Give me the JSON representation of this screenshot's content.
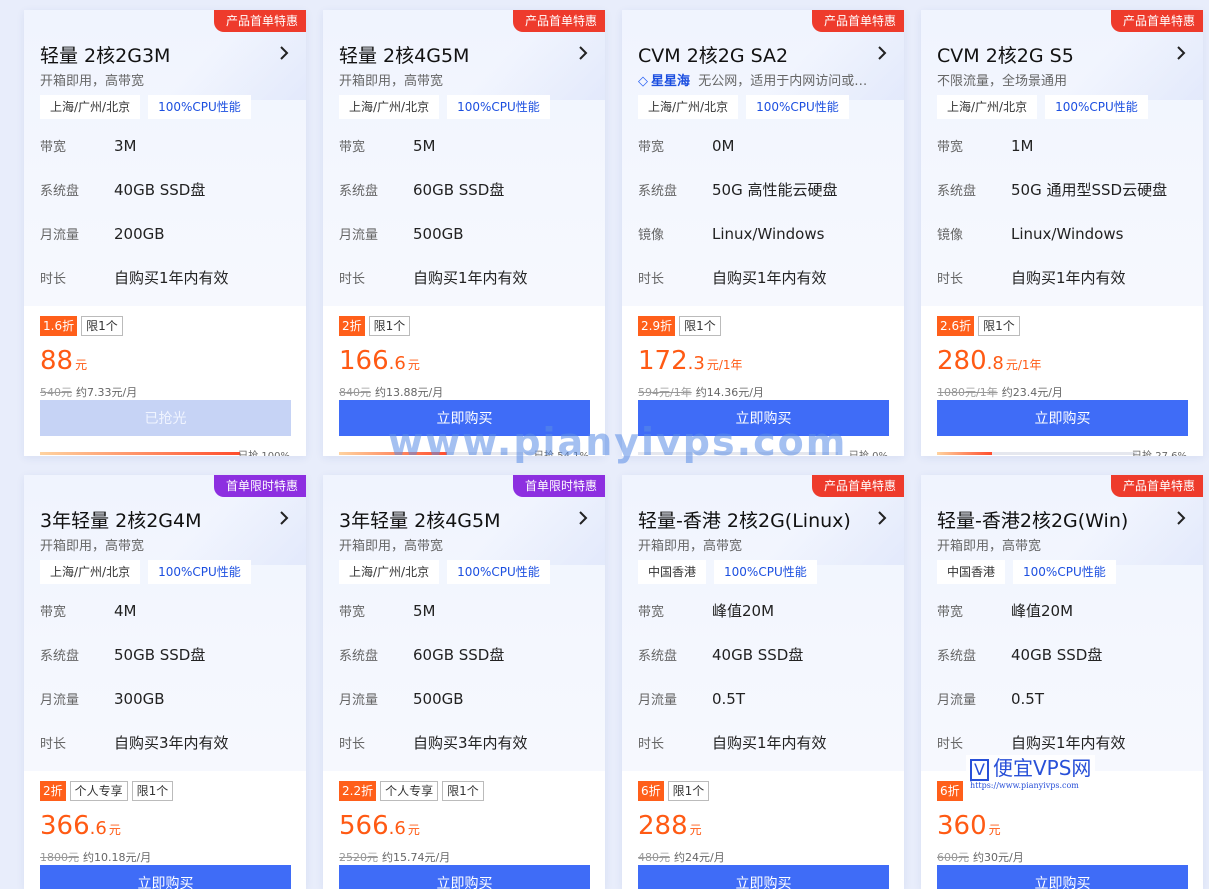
{
  "cards": [
    {
      "ribbon": "产品首单特惠",
      "ribbon_color": "red",
      "title": "轻量 2核2G3M",
      "subtitle": "开箱即用，高带宽",
      "tags": [
        "上海/广州/北京",
        "100%CPU性能"
      ],
      "specs": [
        [
          "带宽",
          "3M"
        ],
        [
          "系统盘",
          "40GB SSD盘"
        ],
        [
          "月流量",
          "200GB"
        ],
        [
          "时长",
          "自购买1年内有效"
        ]
      ],
      "discount": "1.6折",
      "badges": [
        "限1个"
      ],
      "price_int": "88",
      "price_dec": "",
      "price_unit": "元",
      "orig_price": "540元",
      "monthly": "约7.33元/月",
      "button": "已抢光",
      "sold_out": true,
      "progress": 1.0,
      "sold_label": "已抢 100%"
    },
    {
      "ribbon": "产品首单特惠",
      "ribbon_color": "red",
      "title": "轻量 2核4G5M",
      "subtitle": "开箱即用，高带宽",
      "tags": [
        "上海/广州/北京",
        "100%CPU性能"
      ],
      "specs": [
        [
          "带宽",
          "5M"
        ],
        [
          "系统盘",
          "60GB SSD盘"
        ],
        [
          "月流量",
          "500GB"
        ],
        [
          "时长",
          "自购买1年内有效"
        ]
      ],
      "discount": "2折",
      "badges": [
        "限1个"
      ],
      "price_int": "166",
      "price_dec": ".6",
      "price_unit": "元",
      "orig_price": "840元",
      "monthly": "约13.88元/月",
      "button": "立即购买",
      "sold_out": false,
      "progress": 0.541,
      "sold_label": "已抢 54.1%"
    },
    {
      "ribbon": "产品首单特惠",
      "ribbon_color": "red",
      "title": "CVM 2核2G SA2",
      "subtitle_brand": "星星海",
      "subtitle": "无公网，适用于内网访问或…",
      "tags": [
        "上海/广州/北京",
        "100%CPU性能"
      ],
      "specs": [
        [
          "带宽",
          "0M"
        ],
        [
          "系统盘",
          "50G 高性能云硬盘"
        ],
        [
          "镜像",
          "Linux/Windows"
        ],
        [
          "时长",
          "自购买1年内有效"
        ]
      ],
      "discount": "2.9折",
      "badges": [
        "限1个"
      ],
      "price_int": "172",
      "price_dec": ".3",
      "price_unit": "元/1年",
      "orig_price": "594元/1年",
      "monthly": "约14.36元/月",
      "button": "立即购买",
      "sold_out": false,
      "progress": 0.0,
      "sold_label": "已抢 0%"
    },
    {
      "ribbon": "产品首单特惠",
      "ribbon_color": "red",
      "title": "CVM 2核2G S5",
      "subtitle": "不限流量，全场景通用",
      "tags": [
        "上海/广州/北京",
        "100%CPU性能"
      ],
      "specs": [
        [
          "带宽",
          "1M"
        ],
        [
          "系统盘",
          "50G 通用型SSD云硬盘"
        ],
        [
          "镜像",
          "Linux/Windows"
        ],
        [
          "时长",
          "自购买1年内有效"
        ]
      ],
      "discount": "2.6折",
      "badges": [
        "限1个"
      ],
      "price_int": "280",
      "price_dec": ".8",
      "price_unit": "元/1年",
      "orig_price": "1080元/1年",
      "monthly": "约23.4元/月",
      "button": "立即购买",
      "sold_out": false,
      "progress": 0.276,
      "sold_label": "已抢 27.6%"
    },
    {
      "ribbon": "首单限时特惠",
      "ribbon_color": "purple",
      "title": "3年轻量 2核2G4M",
      "subtitle": "开箱即用，高带宽",
      "tags": [
        "上海/广州/北京",
        "100%CPU性能"
      ],
      "specs": [
        [
          "带宽",
          "4M"
        ],
        [
          "系统盘",
          "50GB SSD盘"
        ],
        [
          "月流量",
          "300GB"
        ],
        [
          "时长",
          "自购买3年内有效"
        ]
      ],
      "discount": "2折",
      "badges": [
        "个人专享",
        "限1个"
      ],
      "price_int": "366",
      "price_dec": ".6",
      "price_unit": "元",
      "orig_price": "1800元",
      "monthly": "约10.18元/月",
      "button": "立即购买",
      "sold_out": false
    },
    {
      "ribbon": "首单限时特惠",
      "ribbon_color": "purple",
      "title": "3年轻量 2核4G5M",
      "subtitle": "开箱即用，高带宽",
      "tags": [
        "上海/广州/北京",
        "100%CPU性能"
      ],
      "specs": [
        [
          "带宽",
          "5M"
        ],
        [
          "系统盘",
          "60GB SSD盘"
        ],
        [
          "月流量",
          "500GB"
        ],
        [
          "时长",
          "自购买3年内有效"
        ]
      ],
      "discount": "2.2折",
      "badges": [
        "个人专享",
        "限1个"
      ],
      "price_int": "566",
      "price_dec": ".6",
      "price_unit": "元",
      "orig_price": "2520元",
      "monthly": "约15.74元/月",
      "button": "立即购买",
      "sold_out": false
    },
    {
      "ribbon": "产品首单特惠",
      "ribbon_color": "red",
      "title": "轻量-香港 2核2G(Linux)",
      "subtitle": "开箱即用，高带宽",
      "tags": [
        "中国香港",
        "100%CPU性能"
      ],
      "specs": [
        [
          "带宽",
          "峰值20M"
        ],
        [
          "系统盘",
          "40GB SSD盘"
        ],
        [
          "月流量",
          "0.5T"
        ],
        [
          "时长",
          "自购买1年内有效"
        ]
      ],
      "discount": "6折",
      "badges": [
        "限1个"
      ],
      "price_int": "288",
      "price_dec": "",
      "price_unit": "元",
      "orig_price": "480元",
      "monthly": "约24元/月",
      "button": "立即购买",
      "sold_out": false
    },
    {
      "ribbon": "产品首单特惠",
      "ribbon_color": "red",
      "title": "轻量-香港2核2G(Win)",
      "subtitle": "开箱即用，高带宽",
      "tags": [
        "中国香港",
        "100%CPU性能"
      ],
      "specs": [
        [
          "带宽",
          "峰值20M"
        ],
        [
          "系统盘",
          "40GB SSD盘"
        ],
        [
          "月流量",
          "0.5T"
        ],
        [
          "时长",
          "自购买1年内有效"
        ]
      ],
      "discount": "6折",
      "badges": [],
      "price_int": "360",
      "price_dec": "",
      "price_unit": "元",
      "orig_price": "600元",
      "monthly": "约30元/月",
      "button": "立即购买",
      "sold_out": false
    }
  ],
  "watermark": "www.pianyivps.com",
  "logo": {
    "mark": "V",
    "name": "便宜VPS网",
    "url": "https://www.pianyivps.com"
  }
}
